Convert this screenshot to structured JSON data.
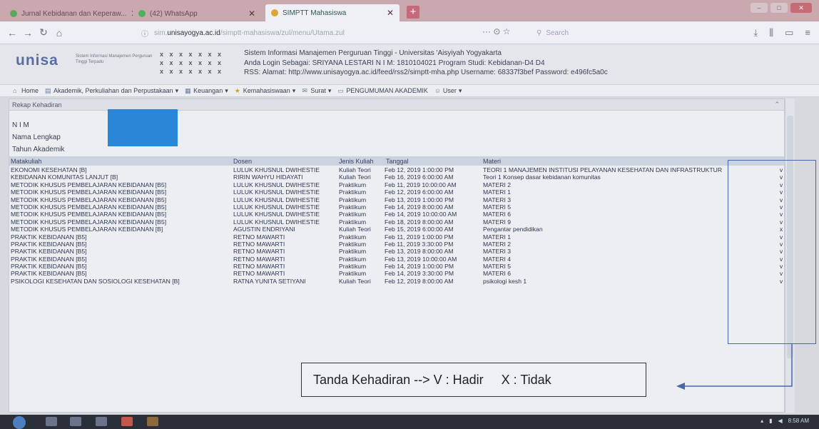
{
  "browser": {
    "tabs": [
      {
        "label": "Jurnal Kebidanan dan Keperaw...",
        "active": false
      },
      {
        "label": "(42) WhatsApp",
        "active": false
      },
      {
        "label": "SIMPTT Mahasiswa",
        "active": true
      }
    ],
    "new_tab_label": "+",
    "url_host": "unisayogya.ac.id",
    "url_prefix": "sim.",
    "url_path": "/simptt-mahasiswa/zul/menu/Utama.zul",
    "url_actions": "··· ⊙ ☆",
    "search_placeholder": "Search",
    "search_icon": "search-icon",
    "right_icons": [
      "download-icon",
      "library-icon",
      "sidebar-icon",
      "menu-icon"
    ]
  },
  "site": {
    "logo": "unisa",
    "logo_sub": "Sistem Informasi Manajemen Perguruan Tinggi Terpadu",
    "system_title": "Sistem Informasi Manajemen Perguruan Tinggi - Universitas 'Aisyiyah Yogyakarta",
    "login_line": "Anda Login Sebagai: SRIYANA LESTARI   N I M: 1810104021   Program Studi: Kebidanan-D4 D4",
    "rss_line": "RSS:   Alamat: http://www.unisayogya.ac.id/feed/rss2/simptt-mha.php   Username: 68337f3bef   Password: e496fc5a0c"
  },
  "menu": [
    {
      "label": "Home",
      "icon": "home-icon"
    },
    {
      "label": "Akademik, Perkuliahan dan Perpustakaan",
      "icon": "book-icon",
      "dropdown": true
    },
    {
      "label": "Keuangan",
      "icon": "money-icon",
      "dropdown": true
    },
    {
      "label": "Kemahasiswaan",
      "icon": "star-icon",
      "dropdown": true
    },
    {
      "label": "Surat",
      "icon": "mail-icon",
      "dropdown": true
    },
    {
      "label": "PENGUMUMAN AKADEMIK",
      "icon": "announce-icon",
      "dropdown": false
    },
    {
      "label": "User",
      "icon": "user-icon",
      "dropdown": true
    }
  ],
  "panel": {
    "title": "Rekap Kehadiran",
    "info_labels": [
      "N I M",
      "Nama Lengkap",
      "Tahun Akademik"
    ],
    "columns": [
      "Matakuliah",
      "Dosen",
      "Jenis Kuliah",
      "Tanggal",
      "Materi",
      ""
    ],
    "rows": [
      [
        "EKONOMI KESEHATAN [B]",
        "LULUK KHUSNUL DWIHESTIE",
        "Kuliah Teori",
        "Feb 12, 2019 1:00:00 PM",
        "TEORI 1 MANAJEMEN INSTITUSI PELAYANAN KESEHATAN DAN INFRASTRUKTUR",
        "v"
      ],
      [
        "KEBIDANAN KOMUNITAS LANJUT [B]",
        "RIRIN WAHYU HIDAYATI",
        "Kuliah Teori",
        "Feb 16, 2019 6:00:00 AM",
        "Teori 1 Konsep dasar kebidanan komunitas",
        "v"
      ],
      [
        "METODIK KHUSUS PEMBELAJARAN KEBIDANAN [B5]",
        "LULUK KHUSNUL DWIHESTIE",
        "Praktikum",
        "Feb 11, 2019 10:00:00 AM",
        "MATERI 2",
        "v"
      ],
      [
        "METODIK KHUSUS PEMBELAJARAN KEBIDANAN [B5]",
        "LULUK KHUSNUL DWIHESTIE",
        "Praktikum",
        "Feb 12, 2019 6:00:00 AM",
        "MATERI 1",
        "v"
      ],
      [
        "METODIK KHUSUS PEMBELAJARAN KEBIDANAN [B5]",
        "LULUK KHUSNUL DWIHESTIE",
        "Praktikum",
        "Feb 13, 2019 1:00:00 PM",
        "MATERI 3",
        "v"
      ],
      [
        "METODIK KHUSUS PEMBELAJARAN KEBIDANAN [B5]",
        "LULUK KHUSNUL DWIHESTIE",
        "Praktikum",
        "Feb 14, 2019 8:00:00 AM",
        "MATERI 5",
        "v"
      ],
      [
        "METODIK KHUSUS PEMBELAJARAN KEBIDANAN [B5]",
        "LULUK KHUSNUL DWIHESTIE",
        "Praktikum",
        "Feb 14, 2019 10:00:00 AM",
        "MATERI 6",
        "v"
      ],
      [
        "METODIK KHUSUS PEMBELAJARAN KEBIDANAN [B5]",
        "LULUK KHUSNUL DWIHESTIE",
        "Praktikum",
        "Feb 18, 2019 8:00:00 AM",
        "MATERI 9",
        "v"
      ],
      [
        "METODIK KHUSUS PEMBELAJARAN KEBIDANAN [B]",
        "AGUSTIN ENDRIYANI",
        "Kuliah Teori",
        "Feb 15, 2019 6:00:00 AM",
        "Pengantar pendidikan",
        "x"
      ],
      [
        "PRAKTIK KEBIDANAN [B5]",
        "RETNO MAWARTI",
        "Praktikum",
        "Feb 11, 2019 1:00:00 PM",
        "MATERI 1",
        "v"
      ],
      [
        "PRAKTIK KEBIDANAN [B5]",
        "RETNO MAWARTI",
        "Praktikum",
        "Feb 11, 2019 3:30:00 PM",
        "MATERI 2",
        "v"
      ],
      [
        "PRAKTIK KEBIDANAN [B5]",
        "RETNO MAWARTI",
        "Praktikum",
        "Feb 13, 2019 8:00:00 AM",
        "MATERI 3",
        "v"
      ],
      [
        "PRAKTIK KEBIDANAN [B5]",
        "RETNO MAWARTI",
        "Praktikum",
        "Feb 13, 2019 10:00:00 AM",
        "MATERI 4",
        "v"
      ],
      [
        "PRAKTIK KEBIDANAN [B5]",
        "RETNO MAWARTI",
        "Praktikum",
        "Feb 14, 2019 1:00:00 PM",
        "MATERI 5",
        "v"
      ],
      [
        "PRAKTIK KEBIDANAN [B5]",
        "RETNO MAWARTI",
        "Praktikum",
        "Feb 14, 2019 3:30:00 PM",
        "MATERI 6",
        "v"
      ],
      [
        "PSIKOLOGI KESEHATAN DAN SOSIOLOGI KESEHATAN [B]",
        "RATNA YUNITA SETIYANI",
        "Kuliah Teori",
        "Feb 12, 2019 8:00:00 AM",
        "psikologi kesh 1",
        "v"
      ]
    ]
  },
  "annotation": {
    "callout_text": "Tanda Kehadiran --> V : Hadir     X : Tidak"
  },
  "taskbar": {
    "clock": "8:58 AM"
  },
  "colors": {
    "tab_strip": "#c9a9ad",
    "info_box": "#2a86d6",
    "annotation_border": "#4a68a8"
  }
}
